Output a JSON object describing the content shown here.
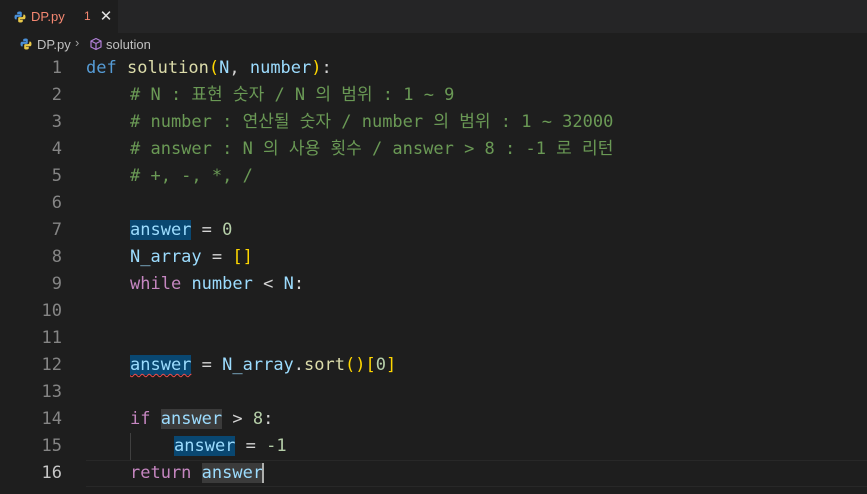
{
  "tab": {
    "filename": "DP.py",
    "problem_count": "1",
    "close_glyph": "✕"
  },
  "breadcrumb": {
    "file": "DP.py",
    "separator": "›",
    "symbol": "solution"
  },
  "editor": {
    "line_numbers": [
      "1",
      "2",
      "3",
      "4",
      "5",
      "6",
      "7",
      "8",
      "9",
      "10",
      "11",
      "12",
      "13",
      "14",
      "15",
      "16"
    ],
    "active_line": "16",
    "lines": {
      "l1": {
        "def": "def",
        "fname": "solution",
        "open": "(",
        "p1": "N",
        "comma": ", ",
        "p2": "number",
        "close": ")",
        "colon": ":"
      },
      "l2": "# N : 표현 숫자 / N 의 범위 : 1 ~ 9",
      "l3": "# number : 연산될 숫자 / number 의 범위 : 1 ~ 32000",
      "l4": "# answer : N 의 사용 횟수 / answer > 8 : -1 로 리턴",
      "l5": "# +, -, *, /",
      "l7": {
        "var": "answer",
        "op": " = ",
        "num": "0"
      },
      "l8": {
        "var": "N_array",
        "op": " = ",
        "brackets": "[]"
      },
      "l9": {
        "kw": "while",
        "v1": "number",
        "op": " < ",
        "v2": "N",
        "colon": ":"
      },
      "l12": {
        "var": "answer",
        "op": " = ",
        "obj": "N_array",
        "dot": ".",
        "method": "sort",
        "call": "()",
        "open": "[",
        "idx": "0",
        "close": "]"
      },
      "l14": {
        "kw": "if",
        "var": "answer",
        "op": " > ",
        "num": "8",
        "colon": ":"
      },
      "l15": {
        "var": "answer",
        "op": " = ",
        "num": "-1"
      },
      "l16": {
        "kw": "return",
        "var": "answer"
      }
    }
  },
  "colors": {
    "background": "#1e1e1e",
    "keyword": "#569cd6",
    "control": "#c586c0",
    "function": "#dcdcaa",
    "variable": "#9cdcfe",
    "number": "#b5cea8",
    "comment": "#6a9955",
    "error": "#f48771"
  }
}
